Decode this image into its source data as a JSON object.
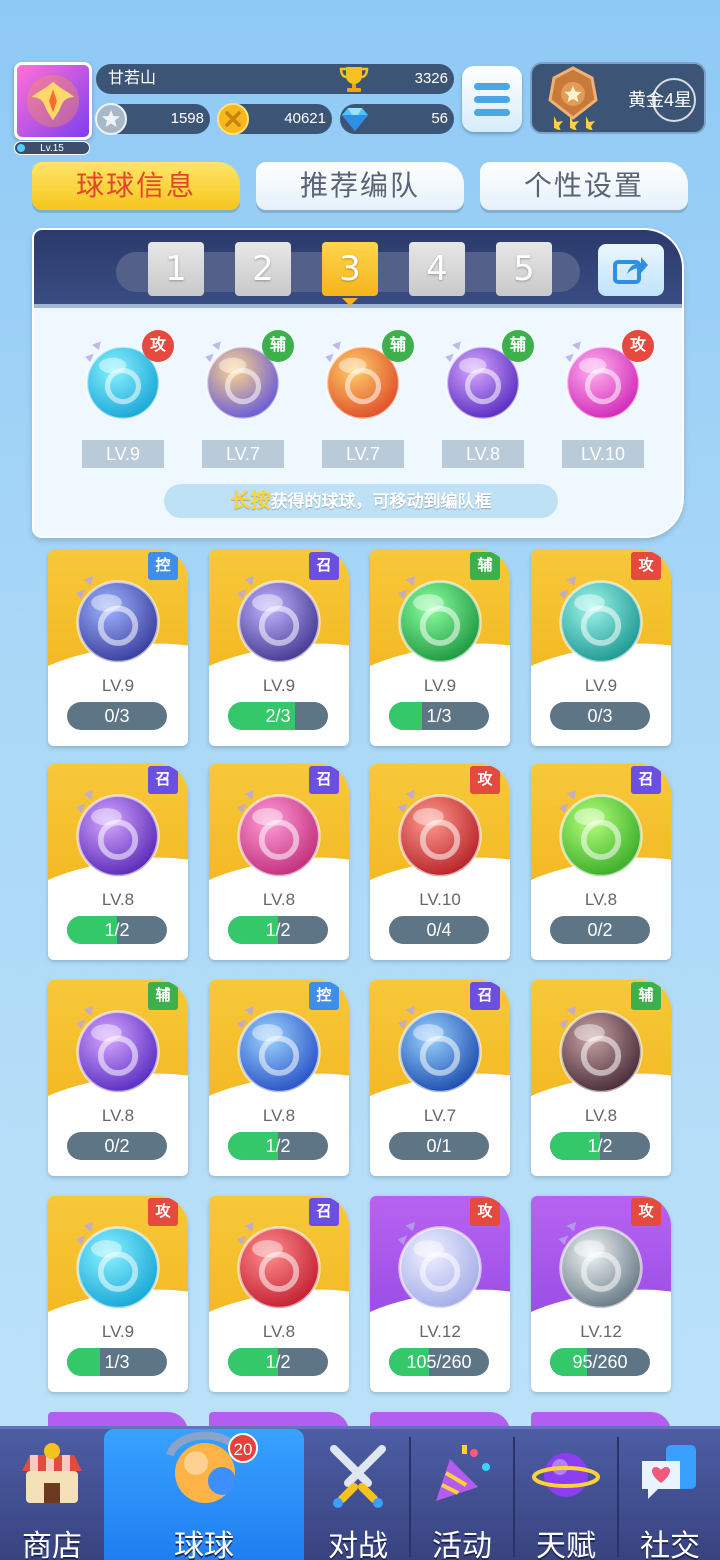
{
  "profile": {
    "name": "甘若山",
    "level": "Lv.15",
    "trophies": "3326",
    "silver": "1598",
    "gold": "40621",
    "gems": "56",
    "rank": "黄金4星"
  },
  "tabs": [
    {
      "label": "球球信息",
      "active": true
    },
    {
      "label": "推荐编队",
      "active": false
    },
    {
      "label": "个性设置",
      "active": false
    }
  ],
  "team": {
    "slots": [
      "1",
      "2",
      "3",
      "4",
      "5"
    ],
    "active_slot": 3,
    "balls": [
      {
        "type": "攻",
        "level": "LV.9",
        "icon": "sword-ball-icon"
      },
      {
        "type": "辅",
        "level": "LV.7",
        "icon": "spirit-ball-icon"
      },
      {
        "type": "辅",
        "level": "LV.7",
        "icon": "wings-ball-icon"
      },
      {
        "type": "辅",
        "level": "LV.8",
        "icon": "sprout-ball-icon"
      },
      {
        "type": "攻",
        "level": "LV.10",
        "icon": "cracked-shield-ball-icon"
      }
    ],
    "tip_highlight": "长按",
    "tip_text": "获得的球球，可移动到编队框"
  },
  "inventory": [
    {
      "type": "控",
      "level": "LV.9",
      "progress": "0/3",
      "fill": 0,
      "color": "gold",
      "icon": "clock-ball-icon"
    },
    {
      "type": "召",
      "level": "LV.9",
      "progress": "2/3",
      "fill": 0.667,
      "color": "gold",
      "icon": "ghost-ball-icon"
    },
    {
      "type": "辅",
      "level": "LV.9",
      "progress": "1/3",
      "fill": 0.333,
      "color": "gold",
      "icon": "star-arrow-ball-icon"
    },
    {
      "type": "攻",
      "level": "LV.9",
      "progress": "0/3",
      "fill": 0,
      "color": "gold",
      "icon": "tornado-ball-icon"
    },
    {
      "type": "召",
      "level": "LV.8",
      "progress": "1/2",
      "fill": 0.5,
      "color": "gold",
      "icon": "orbit-ball-icon"
    },
    {
      "type": "召",
      "level": "LV.8",
      "progress": "1/2",
      "fill": 0.5,
      "color": "gold",
      "icon": "knife-ball-icon"
    },
    {
      "type": "攻",
      "level": "LV.10",
      "progress": "0/4",
      "fill": 0,
      "color": "gold",
      "icon": "fist-ball-icon"
    },
    {
      "type": "召",
      "level": "LV.8",
      "progress": "0/2",
      "fill": 0,
      "color": "gold",
      "icon": "hexagram-ball-icon"
    },
    {
      "type": "辅",
      "level": "LV.8",
      "progress": "0/2",
      "fill": 0,
      "color": "gold",
      "icon": "sprout-ball-icon"
    },
    {
      "type": "控",
      "level": "LV.8",
      "progress": "1/2",
      "fill": 0.5,
      "color": "gold",
      "icon": "snowflake-ball-icon"
    },
    {
      "type": "召",
      "level": "LV.7",
      "progress": "0/1",
      "fill": 0,
      "color": "gold",
      "icon": "ice-gate-ball-icon"
    },
    {
      "type": "辅",
      "level": "LV.8",
      "progress": "1/2",
      "fill": 0.5,
      "color": "gold",
      "icon": "skull-ball-icon"
    },
    {
      "type": "攻",
      "level": "LV.9",
      "progress": "1/3",
      "fill": 0.333,
      "color": "gold",
      "icon": "sword-ball-icon"
    },
    {
      "type": "召",
      "level": "LV.8",
      "progress": "1/2",
      "fill": 0.5,
      "color": "gold",
      "icon": "wheel-ball-icon"
    },
    {
      "type": "攻",
      "level": "LV.12",
      "progress": "105/260",
      "fill": 0.404,
      "color": "purple",
      "icon": "bubble-ball-icon"
    },
    {
      "type": "攻",
      "level": "LV.12",
      "progress": "95/260",
      "fill": 0.365,
      "color": "purple",
      "icon": "swirl-ball-icon"
    }
  ],
  "nav": [
    {
      "label": "商店",
      "icon": "shop-icon"
    },
    {
      "label": "球球",
      "icon": "balls-icon",
      "badge": "20",
      "active": true
    },
    {
      "label": "对战",
      "icon": "crossed-swords-icon"
    },
    {
      "label": "活动",
      "icon": "party-popper-icon"
    },
    {
      "label": "天赋",
      "icon": "planet-icon"
    },
    {
      "label": "社交",
      "icon": "chat-heart-icon"
    }
  ],
  "colors": {
    "attack": "#e54a3f",
    "support": "#3db04c",
    "control": "#3f8ee9",
    "summon": "#6a4fe0",
    "progress_fill": "#35c86b"
  }
}
